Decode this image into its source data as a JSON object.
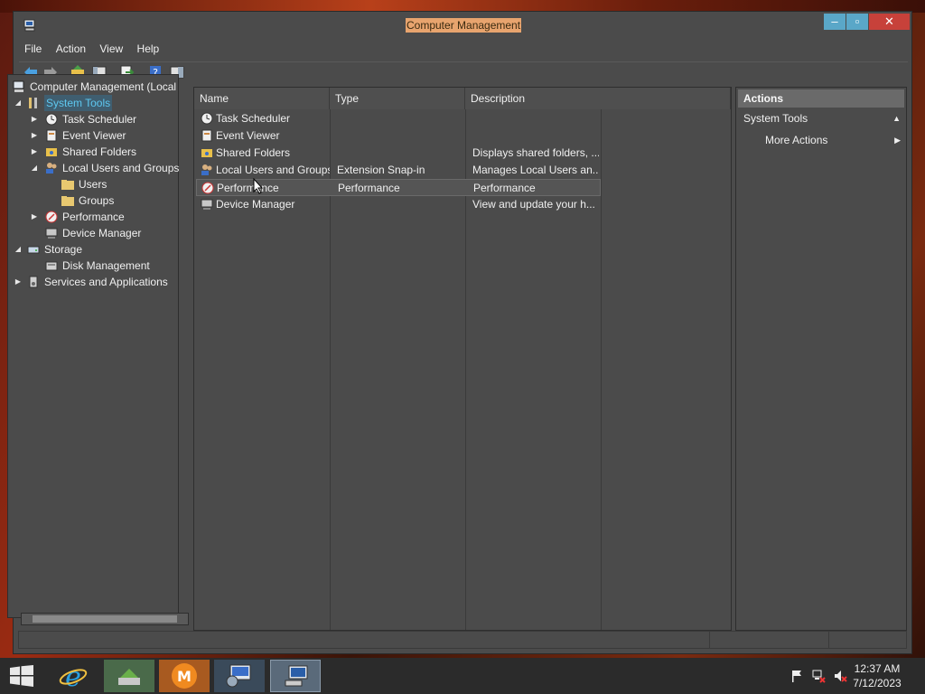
{
  "window": {
    "title": "Computer Management",
    "controls": {
      "minimize": "–",
      "maximize": "▫",
      "close": "✕"
    }
  },
  "menu": [
    "File",
    "Action",
    "View",
    "Help"
  ],
  "toolbar": [
    "back-icon",
    "forward-icon",
    "up-folder-icon",
    "show-hide-tree-icon",
    "export-list-icon",
    "help-icon",
    "show-hide-action-pane-icon"
  ],
  "tree": {
    "root": "Computer Management (Local",
    "items": {
      "system_tools": "System Tools",
      "task_scheduler": "Task Scheduler",
      "event_viewer": "Event Viewer",
      "shared_folders": "Shared Folders",
      "local_users_groups": "Local Users and Groups",
      "users": "Users",
      "groups": "Groups",
      "performance": "Performance",
      "device_manager": "Device Manager",
      "storage": "Storage",
      "disk_management": "Disk Management",
      "services_apps": "Services and Applications"
    }
  },
  "list": {
    "columns": [
      "Name",
      "Type",
      "Description"
    ],
    "rows": [
      {
        "name": "Task Scheduler",
        "type": "",
        "description": ""
      },
      {
        "name": "Event Viewer",
        "type": "",
        "description": ""
      },
      {
        "name": "Shared Folders",
        "type": "",
        "description": "Displays shared folders, ..."
      },
      {
        "name": "Local Users and Groups",
        "type": "Extension Snap-in",
        "description": "Manages Local Users an..."
      },
      {
        "name": "Performance",
        "type": "Performance",
        "description": "Performance"
      },
      {
        "name": "Device Manager",
        "type": "",
        "description": "View and update your h..."
      }
    ]
  },
  "actions": {
    "header": "Actions",
    "section": "System Tools",
    "more": "More Actions"
  },
  "taskbar": {
    "clock_time": "12:37 AM",
    "clock_date": "7/12/2023"
  },
  "colors": {
    "accent_selected": "#5ec8f0",
    "title_highlight": "#e8a46e",
    "close": "#c7413a"
  }
}
